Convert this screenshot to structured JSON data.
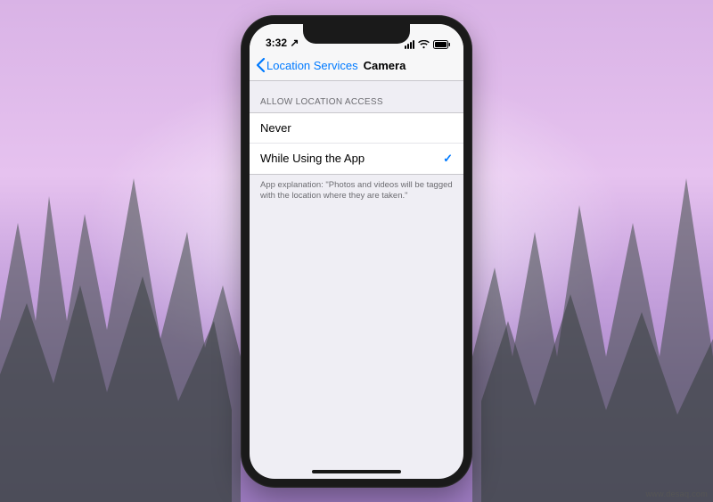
{
  "status": {
    "time": "3:32",
    "network_indicator": "↗"
  },
  "nav": {
    "back_label": "Location Services",
    "title": "Camera"
  },
  "section": {
    "header": "ALLOW LOCATION ACCESS",
    "footer": "App explanation: \"Photos and videos will be tagged with the location where they are taken.\""
  },
  "options": [
    {
      "label": "Never",
      "selected": false
    },
    {
      "label": "While Using the App",
      "selected": true
    }
  ],
  "attribution": "www.desaq.com"
}
